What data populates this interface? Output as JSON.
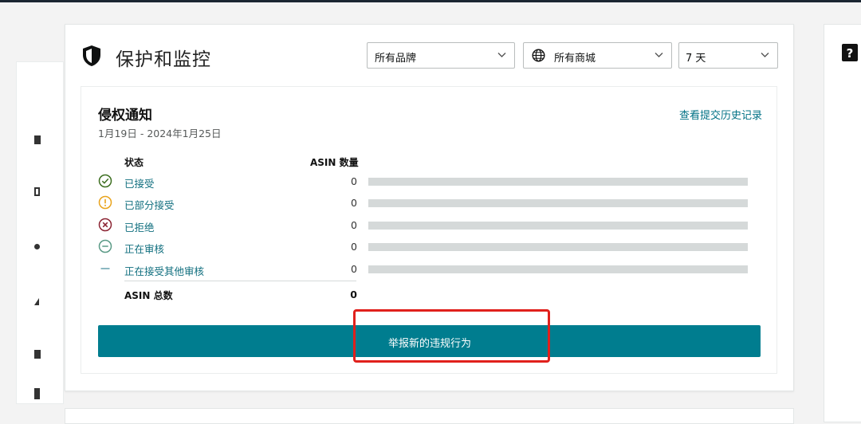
{
  "header": {
    "title": "保护和监控",
    "filters": {
      "brand": "所有品牌",
      "marketplace": "所有商城",
      "period": "7 天"
    }
  },
  "notices": {
    "title": "侵权通知",
    "date_range": "1月19日 - 2024年1月25日",
    "history_link": "查看提交历史记录",
    "col_status": "状态",
    "col_count": "ASIN 数量",
    "rows": [
      {
        "label": "已接受",
        "count": "0",
        "icon": "check-circle-icon",
        "color": "#3c6e1f",
        "fraction": 0
      },
      {
        "label": "已部分接受",
        "count": "0",
        "icon": "alert-circle-icon",
        "color": "#e9a31b",
        "fraction": 0
      },
      {
        "label": "已拒绝",
        "count": "0",
        "icon": "x-circle-icon",
        "color": "#8b2332",
        "fraction": 0
      },
      {
        "label": "正在审核",
        "count": "0",
        "icon": "minus-circle-icon",
        "color": "#5a9a86",
        "fraction": 0
      },
      {
        "label": "正在接受其他审核",
        "count": "0",
        "icon": "dash-icon",
        "color": "#5a9aa8",
        "fraction": 0
      }
    ],
    "total_label": "ASIN 总数",
    "total_value": "0",
    "report_button": "举报新的违规行为"
  },
  "colors": {
    "accent": "#007d8f",
    "link": "#007185",
    "highlight": "#e0201c",
    "bar_track": "#d5d9d9"
  }
}
